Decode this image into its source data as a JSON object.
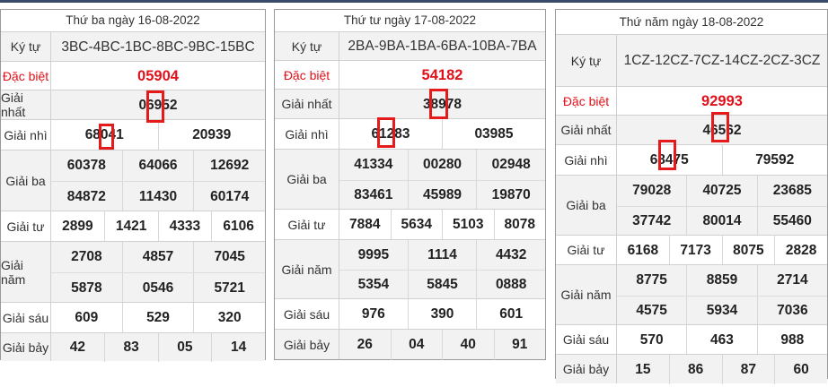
{
  "panels": [
    {
      "title": "Thứ ba ngày 16-08-2022",
      "rows": [
        {
          "label": "Ký tự",
          "lines": [
            [
              "3BC-4BC-1BC-8BC-9BC-15BC"
            ]
          ]
        },
        {
          "label": "Đặc biệt",
          "lines": [
            [
              "05904"
            ]
          ]
        },
        {
          "label": "Giải nhất",
          "lines": [
            [
              "06952"
            ]
          ]
        },
        {
          "label": "Giải nhì",
          "lines": [
            [
              "68041",
              "20939"
            ]
          ]
        },
        {
          "label": "Giải ba",
          "lines": [
            [
              "60378",
              "64066",
              "12692"
            ],
            [
              "84872",
              "11430",
              "60174"
            ]
          ]
        },
        {
          "label": "Giải tư",
          "lines": [
            [
              "2899",
              "1421",
              "4333",
              "6106"
            ]
          ]
        },
        {
          "label": "Giải năm",
          "lines": [
            [
              "2708",
              "4857",
              "7045"
            ],
            [
              "5878",
              "0546",
              "5721"
            ]
          ]
        },
        {
          "label": "Giải sáu",
          "lines": [
            [
              "609",
              "529",
              "320"
            ]
          ]
        },
        {
          "label": "Giải bảy",
          "lines": [
            [
              "42",
              "83",
              "05",
              "14"
            ]
          ]
        }
      ]
    },
    {
      "title": "Thứ tư ngày 17-08-2022",
      "rows": [
        {
          "label": "Ký tự",
          "lines": [
            [
              "2BA-9BA-1BA-6BA-10BA-7BA"
            ]
          ]
        },
        {
          "label": "Đặc biệt",
          "lines": [
            [
              "54182"
            ]
          ]
        },
        {
          "label": "Giải nhất",
          "lines": [
            [
              "38978"
            ]
          ]
        },
        {
          "label": "Giải nhì",
          "lines": [
            [
              "61283",
              "03985"
            ]
          ]
        },
        {
          "label": "Giải ba",
          "lines": [
            [
              "41334",
              "00280",
              "02948"
            ],
            [
              "83461",
              "45989",
              "19870"
            ]
          ]
        },
        {
          "label": "Giải tư",
          "lines": [
            [
              "7884",
              "5634",
              "5103",
              "8078"
            ]
          ]
        },
        {
          "label": "Giải năm",
          "lines": [
            [
              "9995",
              "1114",
              "4432"
            ],
            [
              "5354",
              "5845",
              "0888"
            ]
          ]
        },
        {
          "label": "Giải sáu",
          "lines": [
            [
              "976",
              "390",
              "601"
            ]
          ]
        },
        {
          "label": "Giải bảy",
          "lines": [
            [
              "26",
              "04",
              "40",
              "91"
            ]
          ]
        }
      ]
    },
    {
      "title": "Thứ năm ngày 18-08-2022",
      "rows": [
        {
          "label": "Ký tự",
          "lines": [
            [
              "1CZ-12CZ-7CZ-14CZ-2CZ-3CZ"
            ]
          ]
        },
        {
          "label": "Đặc biệt",
          "lines": [
            [
              "92993"
            ]
          ]
        },
        {
          "label": "Giải nhất",
          "lines": [
            [
              "46562"
            ]
          ]
        },
        {
          "label": "Giải nhì",
          "lines": [
            [
              "68475",
              "79592"
            ]
          ]
        },
        {
          "label": "Giải ba",
          "lines": [
            [
              "79028",
              "40725",
              "23685"
            ],
            [
              "37742",
              "80014",
              "55460"
            ]
          ]
        },
        {
          "label": "Giải tư",
          "lines": [
            [
              "6168",
              "7173",
              "8075",
              "2828"
            ]
          ]
        },
        {
          "label": "Giải năm",
          "lines": [
            [
              "8775",
              "8859",
              "2714"
            ],
            [
              "4575",
              "5934",
              "7036"
            ]
          ]
        },
        {
          "label": "Giải sáu",
          "lines": [
            [
              "570",
              "463",
              "988"
            ]
          ]
        },
        {
          "label": "Giải bảy",
          "lines": [
            [
              "15",
              "86",
              "87",
              "60"
            ]
          ]
        }
      ]
    }
  ],
  "colors": {
    "special": "#e0111a",
    "highlight": "#e51b1b",
    "alt_row": "#f2f2f2"
  }
}
